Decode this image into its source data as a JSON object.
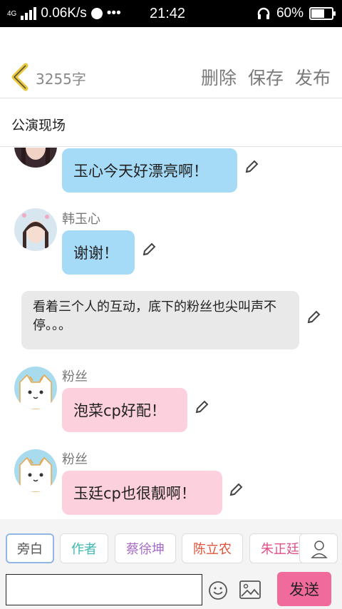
{
  "status_bar": {
    "network": "4G",
    "speed": "0.06K/s",
    "time": "21:42",
    "battery": "60%",
    "battery_level": 0.6
  },
  "header": {
    "word_count": "3255字",
    "delete_label": "删除",
    "save_label": "保存",
    "publish_label": "发布"
  },
  "title": "公演现场",
  "messages": [
    {
      "type": "role",
      "sender": "",
      "text": "玉心今天好漂亮啊！",
      "color": "blue",
      "avatar": "girl-photo"
    },
    {
      "type": "role",
      "sender": "韩玉心",
      "text": "谢谢！",
      "color": "blue",
      "avatar": "girl-photo"
    },
    {
      "type": "narration",
      "text": "看着三个人的互动，底下的粉丝也尖叫声不停。。。"
    },
    {
      "type": "role",
      "sender": "粉丝",
      "text": "泡菜cp好配！",
      "color": "pink",
      "avatar": "cat"
    },
    {
      "type": "role",
      "sender": "粉丝",
      "text": "玉廷cp也很靓啊！",
      "color": "pink",
      "avatar": "cat"
    }
  ],
  "roles": [
    {
      "label": "旁白",
      "color": "#555555"
    },
    {
      "label": "作者",
      "color": "#3cb8b0"
    },
    {
      "label": "蔡徐坤",
      "color": "#a86cc8"
    },
    {
      "label": "陈立农",
      "color": "#e0533a"
    },
    {
      "label": "朱正廷",
      "color": "#e0508a"
    }
  ],
  "input": {
    "value": "",
    "placeholder": ""
  },
  "send_label": "发送",
  "colors": {
    "blue_bubble": "#a6dbf7",
    "pink_bubble": "#fdd0dd",
    "gray_bubble": "#e9e9e9",
    "send_button": "#f06a9b",
    "back_arrow": "#e9c83c"
  }
}
